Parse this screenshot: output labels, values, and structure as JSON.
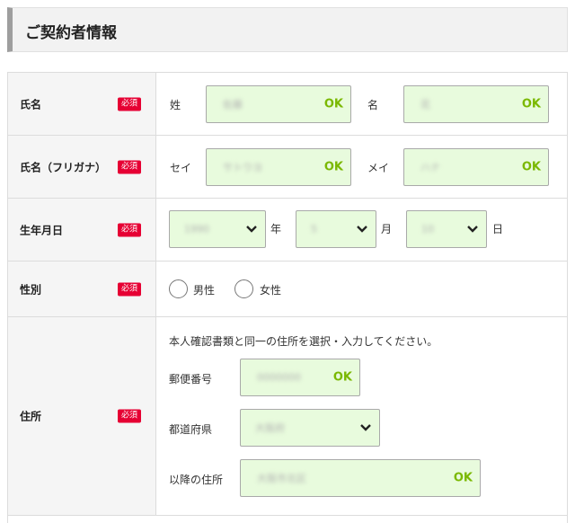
{
  "section": {
    "title": "ご契約者情報"
  },
  "required_badge": "必須",
  "ok_label": "OK",
  "name": {
    "label": "氏名",
    "last_label": "姓",
    "last_value": "佐藤",
    "first_label": "名",
    "first_value": "花"
  },
  "kana": {
    "label": "氏名（フリガナ）",
    "last_label": "セイ",
    "last_value": "サトウヨ",
    "first_label": "メイ",
    "first_value": "ハナ"
  },
  "birth": {
    "label": "生年月日",
    "year_value": "1990",
    "year_unit": "年",
    "month_value": "5",
    "month_unit": "月",
    "day_value": "10",
    "day_unit": "日"
  },
  "gender": {
    "label": "性別",
    "options": [
      "男性",
      "女性"
    ]
  },
  "address": {
    "label": "住所",
    "note": "本人確認書類と同一の住所を選択・入力してください。",
    "postal_label": "郵便番号",
    "postal_value": "0000000",
    "pref_label": "都道府県",
    "pref_value": "大阪府",
    "rest_label": "以降の住所",
    "rest_value": "大阪市北区"
  },
  "colors": {
    "accent_required": "#e60033",
    "field_ok_bg": "#e8fbdd",
    "ok_text": "#7ab800"
  }
}
